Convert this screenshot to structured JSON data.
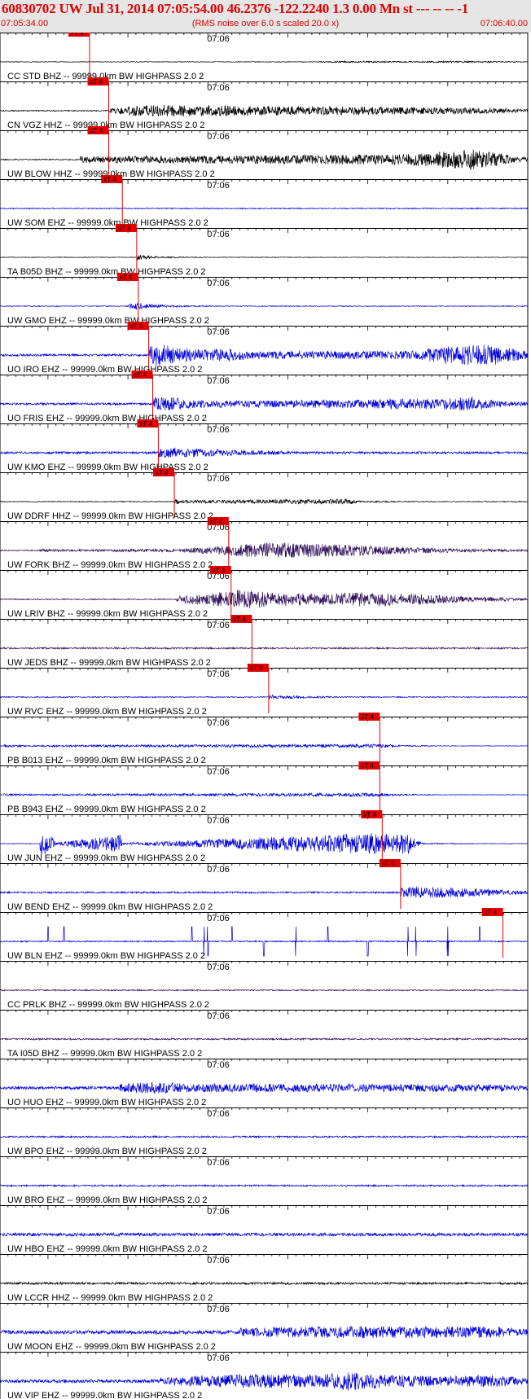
{
  "header": {
    "title": "60830702 UW Jul 31, 2014 07:05:54.00   46.2376 -122.2240  1.3 0.00 Mn st --- -- --  -1",
    "start_time": "07:05:34.00",
    "end_time": "07:06:40.00",
    "subtitle": "(RMS noise over 6.0 s scaled 20.0 x)"
  },
  "chart_data": {
    "type": "line",
    "title": "60830702 UW Jul 31, 2014 07:05:54.00   46.2376 -122.2240  1.3 0.00 Mn st --- -- --  -1",
    "subtitle": "(RMS noise over 6.0 s scaled 20.0 x)",
    "x_range": [
      "07:05:34.00",
      "07:06:40.00"
    ],
    "x_tick_label": "07:06",
    "pick_label": "xT 4",
    "colors": {
      "black": "#000000",
      "blue": "#0000dd",
      "purple": "#30105a",
      "pick": "#e00000"
    },
    "traces": [
      {
        "label": "CC STD BHZ -- 99999.0km BW  HIGHPASS  2.0  2",
        "color": "black",
        "noise": 0.06,
        "pick": 11.2,
        "env": [
          [
            40,
            0.05
          ],
          [
            46,
            0.08
          ],
          [
            52,
            0.05
          ],
          [
            56,
            0.1
          ],
          [
            62,
            0.06
          ]
        ]
      },
      {
        "label": "CN VGZ HHZ -- 99999.0km BW  HIGHPASS  2.0  2",
        "color": "black",
        "noise": 0.1,
        "pick": 13.6,
        "env": [
          [
            13.6,
            0.2
          ],
          [
            16,
            0.8
          ],
          [
            20,
            1.0
          ],
          [
            25,
            0.95
          ],
          [
            32,
            0.8
          ],
          [
            40,
            0.75
          ],
          [
            48,
            0.6
          ],
          [
            56,
            0.55
          ],
          [
            62,
            0.4
          ]
        ]
      },
      {
        "label": "UW BLOW HHZ -- 99999.0km BW  HIGHPASS  2.0  2",
        "color": "black",
        "noise": 0.1,
        "pick": 13.6,
        "env": [
          [
            10,
            0.6
          ],
          [
            13,
            0.5
          ],
          [
            50,
            0.9
          ],
          [
            57,
            1.6
          ],
          [
            59,
            1.8
          ],
          [
            61,
            1.4
          ]
        ]
      },
      {
        "label": "UW SOM EHZ -- 99999.0km BW  HIGHPASS  2.0  2",
        "color": "blue",
        "noise": 0.1,
        "pick": 15.3
      },
      {
        "label": "TA B05D BHZ -- 99999.0km BW  HIGHPASS  2.0  2",
        "color": "black",
        "noise": 0.06,
        "pick": 17.1,
        "env": [
          [
            17.1,
            0.5
          ],
          [
            18,
            0.3
          ],
          [
            20,
            0.1
          ]
        ]
      },
      {
        "label": "UW GMO EHZ -- 99999.0km BW  HIGHPASS  2.0  2",
        "color": "blue",
        "noise": 0.08,
        "pick": 17.3,
        "env": [
          [
            16,
            0.2
          ],
          [
            17.3,
            0.7
          ],
          [
            18.5,
            0.3
          ],
          [
            21,
            0.1
          ]
        ]
      },
      {
        "label": "UO IRO EHZ -- 99999.0km BW  HIGHPASS  2.0  2",
        "color": "blue",
        "noise": 0.2,
        "pick": 18.6,
        "env": [
          [
            18.6,
            1.6
          ],
          [
            20,
            2.0
          ],
          [
            22,
            1.2
          ],
          [
            25,
            0.8
          ],
          [
            28,
            1.0
          ],
          [
            32,
            0.5
          ],
          [
            52,
            0.6
          ],
          [
            56,
            1.5
          ],
          [
            60,
            1.8
          ],
          [
            62,
            1.6
          ]
        ]
      },
      {
        "label": "UO FRIS EHZ -- 99999.0km BW  HIGHPASS  2.0  2",
        "color": "blue",
        "noise": 0.2,
        "pick": 19.1,
        "env": [
          [
            19.1,
            1.0
          ],
          [
            21,
            1.2
          ],
          [
            24,
            0.6
          ],
          [
            30,
            0.4
          ],
          [
            56,
            0.8
          ],
          [
            59,
            1.2
          ],
          [
            62,
            0.4
          ]
        ]
      },
      {
        "label": "UW KMO EHZ -- 99999.0km BW  HIGHPASS  2.0  2",
        "color": "blue",
        "noise": 0.2,
        "pick": 19.8,
        "env": [
          [
            19.8,
            0.6
          ],
          [
            22,
            0.8
          ],
          [
            26,
            0.5
          ],
          [
            32,
            0.3
          ]
        ]
      },
      {
        "label": "UW DDRF HHZ -- 99999.0km BW  HIGHPASS  2.0  2",
        "color": "black",
        "noise": 0.08,
        "pick": 21.8,
        "env": [
          [
            21.8,
            0.5
          ],
          [
            23,
            0.2
          ],
          [
            44,
            0.4
          ],
          [
            45,
            0.1
          ]
        ]
      },
      {
        "label": "UW FORK BHZ -- 99999.0km BW  HIGHPASS  2.0  2",
        "color": "purple",
        "noise": 0.1,
        "pick": 28.6,
        "env": [
          [
            5,
            0.3
          ],
          [
            8,
            0.1
          ],
          [
            22,
            0.2
          ],
          [
            28.6,
            0.8
          ],
          [
            32,
            1.4
          ],
          [
            38,
            1.2
          ],
          [
            44,
            1.0
          ],
          [
            50,
            0.6
          ],
          [
            56,
            0.3
          ],
          [
            62,
            0.2
          ]
        ]
      },
      {
        "label": "UW LRIV BHZ -- 99999.0km BW  HIGHPASS  2.0  2",
        "color": "purple",
        "noise": 0.1,
        "pick": 28.9,
        "env": [
          [
            22,
            0.5
          ],
          [
            28.9,
            1.4
          ],
          [
            30,
            1.8
          ],
          [
            34,
            1.2
          ],
          [
            40,
            1.0
          ],
          [
            46,
            1.3
          ],
          [
            52,
            0.9
          ],
          [
            58,
            0.4
          ],
          [
            62,
            0.3
          ]
        ]
      },
      {
        "label": "UW JEDS BHZ -- 99999.0km BW  HIGHPASS  2.0  2",
        "color": "purple",
        "noise": 0.15,
        "pick": 31.5
      },
      {
        "label": "UW RVC EHZ -- 99999.0km BW  HIGHPASS  2.0  2",
        "color": "blue",
        "noise": 0.1,
        "pick": 33.6,
        "env": [
          [
            33.6,
            0.3
          ],
          [
            36,
            0.2
          ]
        ]
      },
      {
        "label": "PB B013 EHZ -- 99999.0km BW  HIGHPASS  2.0  2",
        "color": "blue",
        "noise": 0.05,
        "pick": 47.5,
        "env": [
          [
            0.5,
            0.2
          ],
          [
            3,
            0.1
          ],
          [
            47.5,
            0.3
          ],
          [
            50,
            0.1
          ]
        ]
      },
      {
        "label": "PB B943 EHZ -- 99999.0km BW  HIGHPASS  2.0  2",
        "color": "blue",
        "noise": 0.05,
        "pick": 47.5,
        "env": [
          [
            0.5,
            0.2
          ],
          [
            3,
            0.1
          ],
          [
            47.5,
            0.3
          ],
          [
            50,
            0.1
          ]
        ]
      },
      {
        "label": "UW JUN EHZ -- 99999.0km BW  HIGHPASS  2.0  2",
        "color": "blue",
        "noise": 0.06,
        "pick": 47.8,
        "env": [
          [
            5,
            2.0
          ],
          [
            6.5,
            2.0
          ],
          [
            7,
            0.2
          ],
          [
            15,
            1.6
          ],
          [
            15.4,
            0.1
          ],
          [
            47.8,
            2.0
          ],
          [
            49,
            1.6
          ],
          [
            51,
            2.0
          ],
          [
            52,
            0.6
          ],
          [
            53,
            0.1
          ]
        ]
      },
      {
        "label": "UW BEND EHZ -- 99999.0km BW  HIGHPASS  2.0  2",
        "color": "blue",
        "noise": 0.15,
        "pick": 50.1,
        "env": [
          [
            50.1,
            0.7
          ],
          [
            52,
            1.0
          ],
          [
            56,
            0.8
          ],
          [
            60,
            0.6
          ],
          [
            62,
            0.4
          ]
        ]
      },
      {
        "label": "UW BLN EHZ -- 99999.0km BW  HIGHPASS  2.0  2",
        "color": "blue",
        "noise": 0.12,
        "pick": 62.9,
        "spikes": [
          6,
          8,
          24,
          25.5,
          26,
          29,
          33,
          37,
          41,
          46,
          51,
          52,
          56,
          60
        ]
      },
      {
        "label": "CC PRLK BHZ -- 99999.0km BW  HIGHPASS  2.0  2",
        "color": "purple",
        "noise": 0.12
      },
      {
        "label": "TA I05D BHZ -- 99999.0km BW  HIGHPASS  2.0  2",
        "color": "purple",
        "noise": 0.15
      },
      {
        "label": "UO HUO EHZ -- 99999.0km BW  HIGHPASS  2.0  2",
        "color": "blue",
        "noise": 0.3,
        "env": [
          [
            15,
            0.5
          ],
          [
            20,
            0.8
          ],
          [
            24,
            0.5
          ],
          [
            62,
            0.4
          ]
        ]
      },
      {
        "label": "UW BPO EHZ -- 99999.0km BW  HIGHPASS  2.0  2",
        "color": "blue",
        "noise": 0.15
      },
      {
        "label": "UW BRO EHZ -- 99999.0km BW  HIGHPASS  2.0  2",
        "color": "blue",
        "noise": 0.15
      },
      {
        "label": "UW HBO EHZ -- 99999.0km BW  HIGHPASS  2.0  2",
        "color": "blue",
        "noise": 0.3
      },
      {
        "label": "UW LCCR HHZ -- 99999.0km BW  HIGHPASS  2.0  2",
        "color": "black",
        "noise": 0.2
      },
      {
        "label": "UW MOON EHZ -- 99999.0km BW  HIGHPASS  2.0  2",
        "color": "blue",
        "noise": 0.35,
        "env": [
          [
            30,
            0.5
          ],
          [
            45,
            0.8
          ],
          [
            62,
            0.7
          ]
        ]
      },
      {
        "label": "UW VIP EHZ -- 99999.0km BW  HIGHPASS  2.0  2",
        "color": "blue",
        "noise": 0.3,
        "env": [
          [
            20,
            0.4
          ],
          [
            30,
            1.0
          ],
          [
            40,
            0.9
          ],
          [
            44,
            1.6
          ],
          [
            48,
            0.9
          ],
          [
            56,
            0.6
          ],
          [
            62,
            0.9
          ]
        ]
      }
    ]
  }
}
